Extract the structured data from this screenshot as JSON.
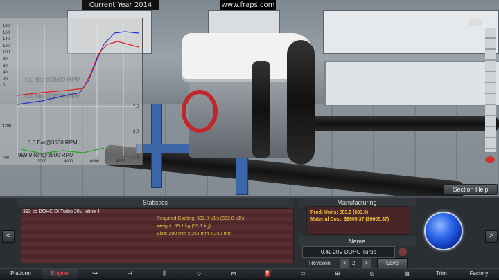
{
  "topbar": {
    "year_label": "Current Year 2014",
    "watermark": "www.fraps.com"
  },
  "graph": {
    "lines": [
      "0.0 Bar@3500 RPM",
      "999.9 Nm@3500 RPM"
    ],
    "ghost_lines": [
      "0.0 Bar@3500 RPM",
      "0.0 Nm@3500 RPM"
    ],
    "y_ticks_top": [
      "180",
      "160",
      "140",
      "120",
      "100",
      "80",
      "60",
      "40",
      "20",
      "0"
    ],
    "y_ticks_bottom": [
      "3200",
      "700"
    ],
    "x_ticks": [
      "2000",
      "4000",
      "6000",
      "8000"
    ],
    "right_ticks": [
      "7.0",
      "3.0",
      "1.0"
    ]
  },
  "section_help": "Section Help",
  "statistics": {
    "header": "Statistics",
    "title": "393 cc DOHC DI Turbo 20V Inline 4",
    "cooling": "Required Cooling: 332.0 kJ/s (332.0 kJ/s)",
    "weight": "Weight: 55.1 kg (55.1 kg)",
    "size": "Size: 290 mm x 254 mm x 240 mm"
  },
  "manufacturing": {
    "header": "Manufacturing",
    "prod_units": "Prod. Units: 683.9 (683.9)",
    "material_cost": "Material Cost: $9605.37 ($9605.37)"
  },
  "name_section": {
    "header": "Name",
    "value": "0.4L 20V DOHC Turbo",
    "revision_label": "Revision",
    "revision_value": "2",
    "save": "Save",
    "dec": "<",
    "inc": ">"
  },
  "nav": {
    "prev": "<",
    "next": ">"
  },
  "tabs": {
    "platform": "Platform",
    "engine": "Engine",
    "trim": "Trim",
    "factory": "Factory"
  },
  "colors": {
    "accent_red": "#ff4a4a",
    "value_yellow": "#e2c04a",
    "orb_blue": "#2a64e8"
  }
}
